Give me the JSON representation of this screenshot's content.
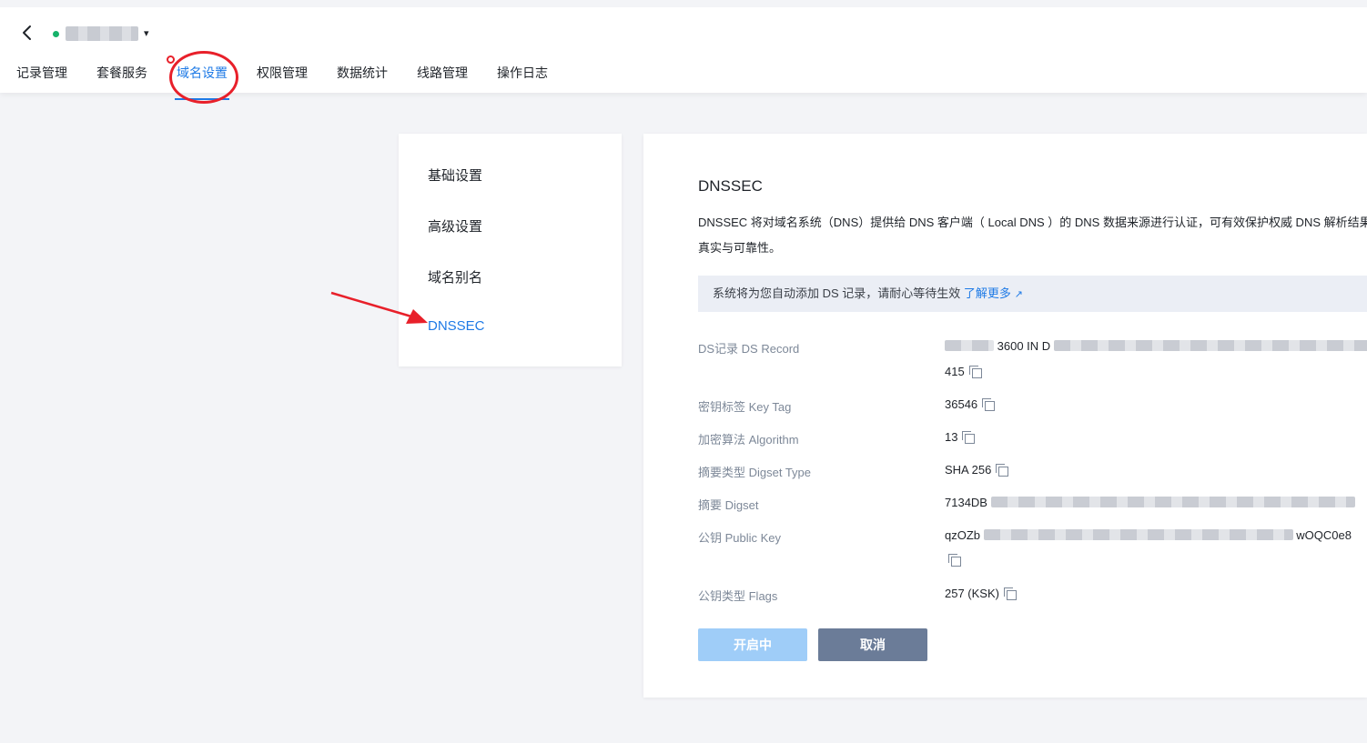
{
  "header": {
    "back_icon": "chevron-left-icon",
    "status_color": "#17b26a",
    "caret": "▾"
  },
  "tabs": [
    {
      "label": "记录管理"
    },
    {
      "label": "套餐服务"
    },
    {
      "label": "域名设置",
      "active": true
    },
    {
      "label": "权限管理"
    },
    {
      "label": "数据统计"
    },
    {
      "label": "线路管理"
    },
    {
      "label": "操作日志"
    }
  ],
  "sidemenu": {
    "items": [
      {
        "label": "基础设置"
      },
      {
        "label": "高级设置"
      },
      {
        "label": "域名别名"
      },
      {
        "label": "DNSSEC",
        "active": true
      }
    ]
  },
  "panel": {
    "title": "DNSSEC",
    "description": "DNSSEC 将对域名系统（DNS）提供给 DNS 客户端（ Local DNS ）的 DNS 数据来源进行认证，可有效保护权威 DNS 解析结果的真实与可靠性。",
    "notice": "系统将为您自动添加 DS 记录，请耐心等待生效",
    "notice_link": "了解更多",
    "notice_link_icon": "↗",
    "fields": {
      "ds_record": {
        "label": "DS记录 DS Record",
        "value_mid": "3600 IN D",
        "value_tail": "415"
      },
      "key_tag": {
        "label": "密钥标签 Key Tag",
        "value": "36546"
      },
      "algorithm": {
        "label": "加密算法 Algorithm",
        "value": "13"
      },
      "digest_type": {
        "label": "摘要类型 Digset Type",
        "value": "SHA 256"
      },
      "digest": {
        "label": "摘要 Digset",
        "value": "7134DB"
      },
      "public_key": {
        "label": "公钥 Public Key",
        "value_head": "qzOZb",
        "value_tail": "wOQC0e8"
      },
      "flags": {
        "label": "公钥类型 Flags",
        "value": "257 (KSK)"
      }
    },
    "buttons": {
      "enable_label": "开启中",
      "cancel_label": "取消"
    }
  },
  "colors": {
    "accent": "#1e7ae6",
    "annotation": "#e8202a",
    "primary_disabled": "#9fcdf8",
    "cancel_bg": "#6b7c98"
  }
}
